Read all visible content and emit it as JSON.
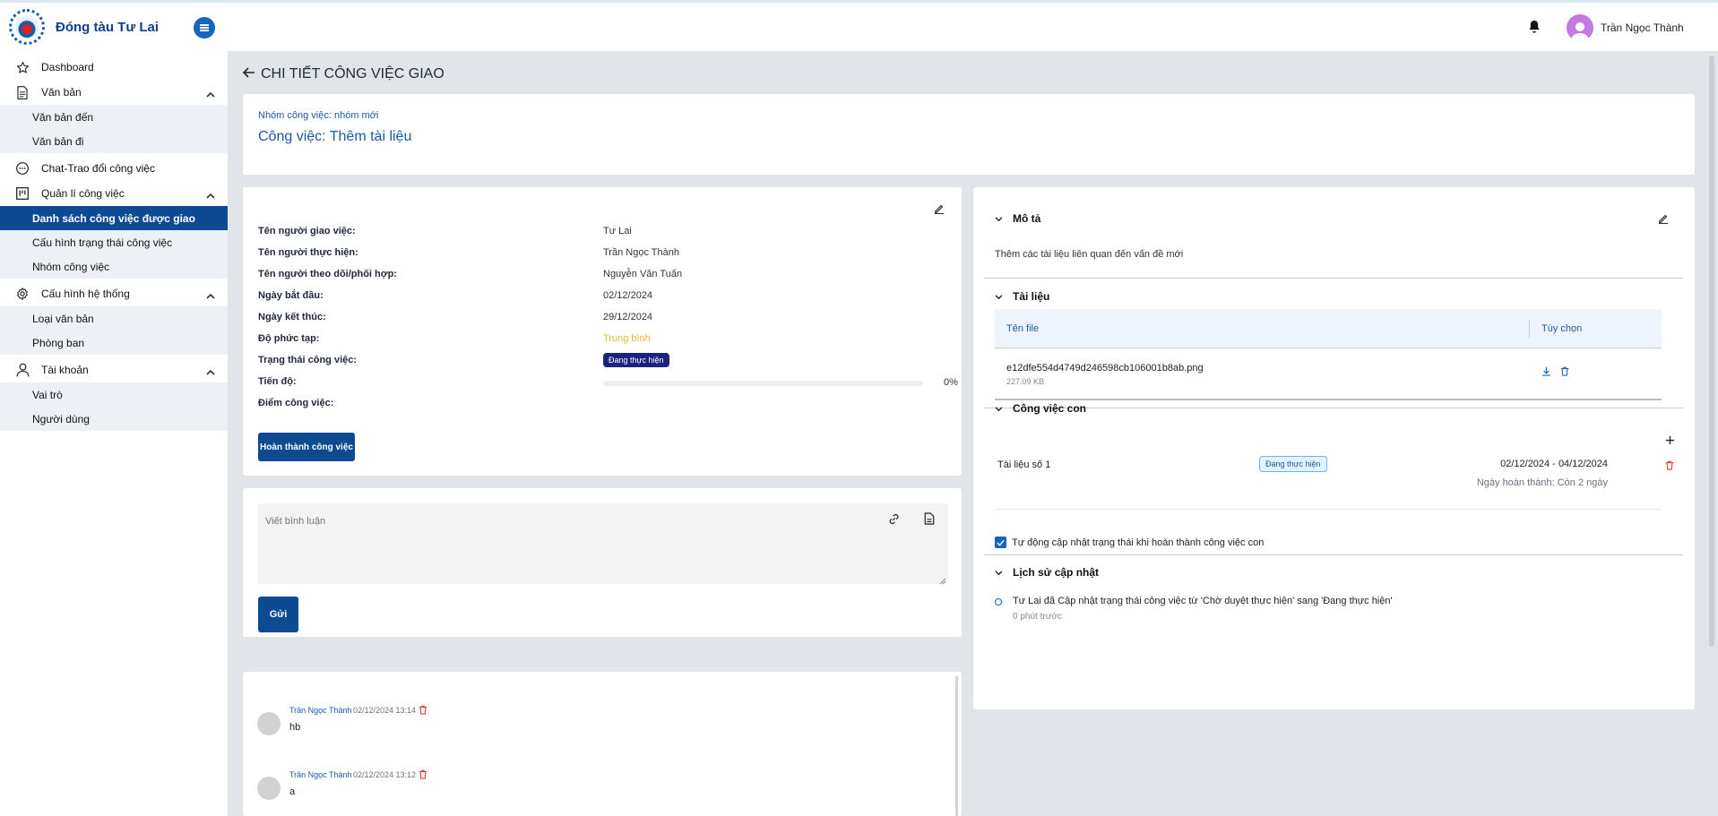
{
  "app": {
    "brand_name": "Đóng tàu Tư Lai"
  },
  "sidebar": {
    "items": [
      {
        "label": "Dashboard"
      },
      {
        "label": "Văn bản",
        "children": [
          {
            "label": "Văn bản đến"
          },
          {
            "label": "Văn bản đi"
          }
        ]
      },
      {
        "label": "Chat-Trao đổi công việc"
      },
      {
        "label": "Quản lí công việc",
        "children": [
          {
            "label": "Danh sách công việc được giao"
          },
          {
            "label": "Cấu hình trạng thái công việc"
          },
          {
            "label": "Nhóm công việc"
          }
        ]
      },
      {
        "label": "Cấu hình hệ thống",
        "children": [
          {
            "label": "Loại văn bản"
          },
          {
            "label": "Phòng ban"
          }
        ]
      },
      {
        "label": "Tài khoản",
        "children": [
          {
            "label": "Vai trò"
          },
          {
            "label": "Người dùng"
          }
        ]
      }
    ]
  },
  "header": {
    "user_name": "Trần Ngọc Thành"
  },
  "page": {
    "title": "CHI TIẾT CÔNG VIỆC GIAO",
    "group_label": "Nhóm công việc: nhóm mới",
    "task_title": "Công việc: Thêm tài liệu"
  },
  "info": {
    "rows": [
      {
        "key": "Tên người giao việc:",
        "value": "Tư Lai"
      },
      {
        "key": "Tên người thực hiện:",
        "value": "Trần Ngọc Thành"
      },
      {
        "key": "Tên người theo dõi/phối hợp:",
        "value": "Nguyễn Văn Tuấn"
      },
      {
        "key": "Ngày bắt đầu:",
        "value": "02/12/2024"
      },
      {
        "key": "Ngày kết thúc:",
        "value": "29/12/2024"
      },
      {
        "key": "Độ phức tạp:",
        "value": "Trung bình"
      },
      {
        "key": "Trạng thái công việc:",
        "value": "Đang thực hiện"
      },
      {
        "key": "Tiến độ:",
        "value": "0%"
      },
      {
        "key": "Điểm công việc:",
        "value": ""
      }
    ],
    "progress_fraction": 0,
    "complete_button": "Hoàn thành công việc"
  },
  "comment_form": {
    "placeholder": "Viết bình luận",
    "send_label": "Gửi"
  },
  "comments": [
    {
      "author": "Trần Ngọc Thành",
      "time": "02/12/2024 13:14",
      "text": "hb"
    },
    {
      "author": "Trần Ngọc Thành",
      "time": "02/12/2024 13:12",
      "text": "a"
    }
  ],
  "right": {
    "description_title": "Mô tả",
    "description_text": "Thêm các tài liệu liên quan đến vấn đề mới",
    "documents_title": "Tài liệu",
    "file_col": "Tên file",
    "options_col": "Tùy chọn",
    "file": {
      "name": "e12dfe554d4749d246598cb106001b8ab.png",
      "size": "227.09 KB"
    },
    "subtasks_title": "Công việc con",
    "subtask": {
      "name": "Tài liệu số 1",
      "status": "Đang thực hiện",
      "dates": "02/12/2024 - 04/12/2024",
      "due": "Ngày hoàn thành: Còn 2 ngày"
    },
    "auto_update_label": "Tự động cập nhật trạng thái khi hoàn thành công việc con",
    "history_title": "Lịch sử cập nhật",
    "history_entry": "Tư Lai đã Cập nhật trạng thái công việc từ 'Chờ duyệt thực hiện' sang 'Đang thực hiện'",
    "history_ago": "0 phút trước"
  },
  "colors": {
    "primary": "#0d4a91",
    "accent": "#1565c0",
    "warning": "#f0b237",
    "danger": "#e53935"
  }
}
